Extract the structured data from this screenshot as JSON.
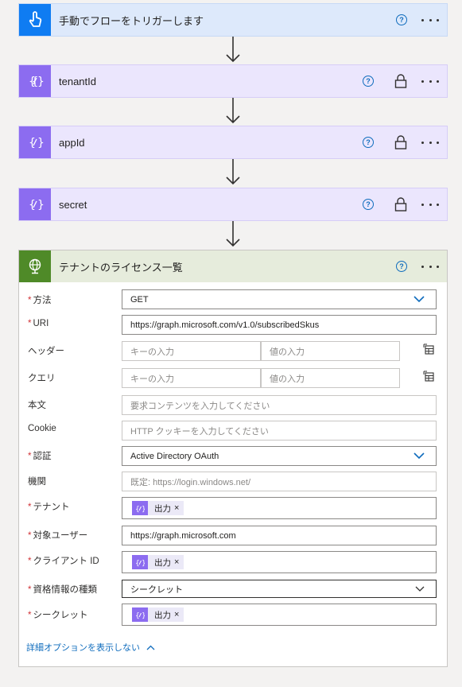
{
  "steps": {
    "trigger": {
      "title": "手動でフローをトリガーします",
      "color": "#0f7cf2",
      "header_bg": "#dde9fb"
    },
    "tenantId": {
      "title": "tenantId",
      "color": "#8c6cf0",
      "header_bg": "#ebe6fd"
    },
    "appId": {
      "title": "appId",
      "color": "#8c6cf0",
      "header_bg": "#ebe6fd"
    },
    "secret": {
      "title": "secret",
      "color": "#8c6cf0",
      "header_bg": "#ebe6fd"
    },
    "http": {
      "title": "テナントのライセンス一覧",
      "color": "#4f8a28",
      "header_bg": "#e6ecdc"
    }
  },
  "help_glyph": "?",
  "form": {
    "method": {
      "label": "方法",
      "value": "GET"
    },
    "uri": {
      "label": "URI",
      "value": "https://graph.microsoft.com/v1.0/subscribedSkus"
    },
    "headers": {
      "label": "ヘッダー",
      "key_placeholder": "キーの入力",
      "value_placeholder": "値の入力"
    },
    "queries": {
      "label": "クエリ",
      "key_placeholder": "キーの入力",
      "value_placeholder": "値の入力"
    },
    "body": {
      "label": "本文",
      "placeholder": "要求コンテンツを入力してください"
    },
    "cookie": {
      "label": "Cookie",
      "placeholder": "HTTP クッキーを入力してください"
    },
    "auth": {
      "label": "認証",
      "value": "Active Directory OAuth"
    },
    "authority": {
      "label": "機関",
      "placeholder": "既定: https://login.windows.net/"
    },
    "tenant": {
      "label": "テナント",
      "token": "出力"
    },
    "audience": {
      "label": "対象ユーザー",
      "value": "https://graph.microsoft.com"
    },
    "client_id": {
      "label": "クライアント ID",
      "token": "出力"
    },
    "credential_type": {
      "label": "資格情報の種類",
      "value": "シークレット"
    },
    "secret": {
      "label": "シークレット",
      "token": "出力"
    },
    "token_remove": "×",
    "required_mark": "*"
  },
  "advanced_link": "詳細オプションを表示しない",
  "colors": {
    "accent": "#0f6cbd",
    "required": "#d13438",
    "variable": "#8c6cf0"
  },
  "icons": [
    "hand-touch-icon",
    "variable-icon",
    "globe-icon",
    "help-icon",
    "lock-icon",
    "more-icon",
    "chevron-down-icon",
    "chevron-up-icon",
    "arrow-down-icon",
    "table-switch-icon"
  ]
}
